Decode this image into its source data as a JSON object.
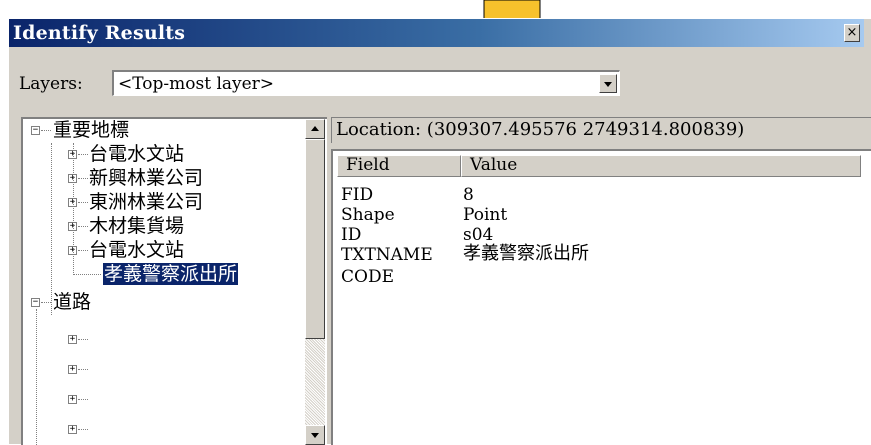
{
  "window": {
    "title": "Identify Results",
    "close_glyph": "×"
  },
  "layers": {
    "label": "Layers:",
    "selected": "<Top-most layer>"
  },
  "tree": {
    "root1": {
      "label": "重要地標",
      "toggle": "−",
      "children": [
        "台電水文站",
        "新興林業公司",
        "東洲林業公司",
        "木材集貨場",
        "台電水文站"
      ],
      "selected_leaf": "孝義警察派出所"
    },
    "root2": {
      "label": "道路",
      "toggle": "−"
    }
  },
  "location": {
    "text": "Location: (309307.495576 2749314.800839)"
  },
  "results": {
    "columns": [
      "Field",
      "Value"
    ],
    "rows": [
      {
        "field": "FID",
        "value": "8"
      },
      {
        "field": "Shape",
        "value": "Point"
      },
      {
        "field": "ID",
        "value": "s04"
      },
      {
        "field": "TXTNAME",
        "value": "孝義警察派出所"
      },
      {
        "field": "CODE",
        "value": ""
      }
    ]
  },
  "colors": {
    "title_start": "#0a246a",
    "title_end": "#a6caf0",
    "arrow_fill": "#f7c12c",
    "selection": "#0a246a"
  }
}
